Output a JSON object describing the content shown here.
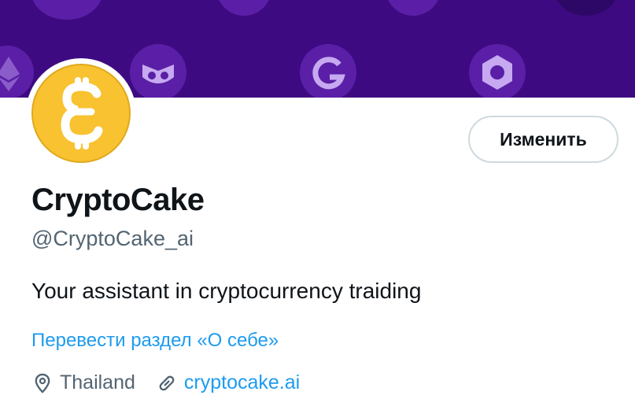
{
  "profile": {
    "display_name": "CryptoCake",
    "handle": "@CryptoCake_ai",
    "bio": "Your assistant in cryptocurrency traiding",
    "translate_label": "Перевести раздел «О себе»",
    "location": "Thailand",
    "website": "cryptocake.ai",
    "avatar_icon": "crypto-cake-coin-logo"
  },
  "actions": {
    "edit_label": "Изменить"
  },
  "colors": {
    "banner": "#3e0a82",
    "avatar_coin": "#f8c230",
    "link": "#1d9bf0",
    "secondary_text": "#536471"
  }
}
